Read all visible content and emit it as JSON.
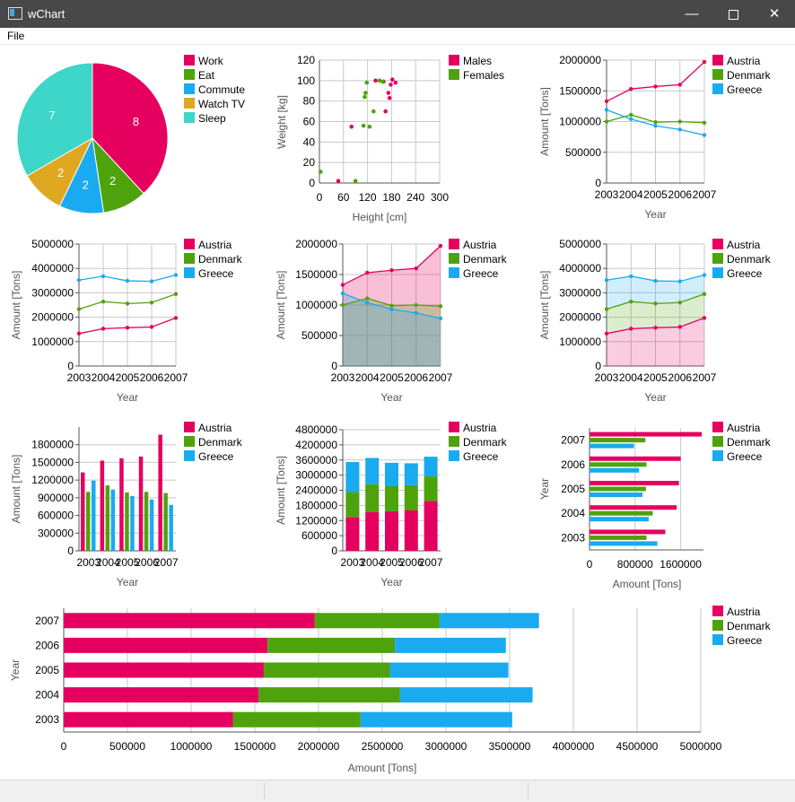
{
  "window": {
    "title": "wChart",
    "minimize_glyph": "—",
    "close_glyph": "✕"
  },
  "menu": {
    "file": "File"
  },
  "icons": [
    "app-icon",
    "minimize-icon",
    "maximize-icon",
    "close-icon"
  ],
  "colors": {
    "austria": "#e5005f",
    "denmark": "#4ea30c",
    "greece": "#1aaaf0",
    "work": "#e5005f",
    "eat": "#4ea30c",
    "commute": "#1aaaf0",
    "watch_tv": "#e0a820",
    "sleep": "#3dd6c8",
    "grid": "#c8c8c8",
    "axis": "#8a8a8a"
  },
  "chart_data": [
    {
      "type": "pie",
      "slices": [
        {
          "label": "Work",
          "value": 8
        },
        {
          "label": "Eat",
          "value": 2
        },
        {
          "label": "Commute",
          "value": 2
        },
        {
          "label": "Watch TV",
          "value": 2
        },
        {
          "label": "Sleep",
          "value": 7
        }
      ],
      "legend": "right"
    },
    {
      "type": "scatter",
      "xlabel": "Height [cm]",
      "ylabel": "Weight [kg]",
      "xlim": [
        0,
        300
      ],
      "ylim": [
        0,
        120
      ],
      "xticks": [
        "0",
        "60",
        "120",
        "180",
        "240",
        "300"
      ],
      "yticks": [
        "0",
        "20",
        "40",
        "60",
        "80",
        "100",
        "120"
      ],
      "series": [
        {
          "name": "Males",
          "points": [
            [
              47,
              2
            ],
            [
              80,
              55
            ],
            [
              140,
              100
            ],
            [
              160,
              99
            ],
            [
              165,
              70
            ],
            [
              172,
              88
            ],
            [
              175,
              83
            ],
            [
              178,
              96
            ],
            [
              182,
              101
            ],
            [
              190,
              98
            ]
          ]
        },
        {
          "name": "Females",
          "points": [
            [
              3,
              11
            ],
            [
              90,
              2
            ],
            [
              110,
              56
            ],
            [
              113,
              84
            ],
            [
              115,
              88
            ],
            [
              118,
              98
            ],
            [
              125,
              55
            ],
            [
              135,
              70
            ],
            [
              150,
              100
            ],
            [
              158,
              99
            ]
          ]
        }
      ],
      "grid": true,
      "legend": "right"
    },
    {
      "type": "line",
      "xlabel": "Year",
      "ylabel": "Amount [Tons]",
      "categories": [
        "2003",
        "2004",
        "2005",
        "2006",
        "2007"
      ],
      "ylim": [
        0,
        2000000
      ],
      "yticks": [
        "0",
        "500000",
        "1000000",
        "1500000",
        "2000000"
      ],
      "series": [
        {
          "name": "Austria",
          "values": [
            1330000,
            1530000,
            1570000,
            1600000,
            1970000
          ]
        },
        {
          "name": "Denmark",
          "values": [
            1000000,
            1110000,
            990000,
            1000000,
            980000
          ]
        },
        {
          "name": "Greece",
          "values": [
            1190000,
            1040000,
            930000,
            870000,
            780000
          ]
        }
      ],
      "grid": true,
      "legend": "right"
    },
    {
      "type": "line",
      "stacked": true,
      "xlabel": "Year",
      "ylabel": "Amount [Tons]",
      "categories": [
        "2003",
        "2004",
        "2005",
        "2006",
        "2007"
      ],
      "ylim": [
        0,
        5000000
      ],
      "yticks": [
        "0",
        "1000000",
        "2000000",
        "3000000",
        "4000000",
        "5000000"
      ],
      "series": [
        {
          "name": "Austria",
          "values": [
            1330000,
            1530000,
            1570000,
            1600000,
            1970000
          ]
        },
        {
          "name": "Denmark",
          "values": [
            1000000,
            1110000,
            990000,
            1000000,
            980000
          ]
        },
        {
          "name": "Greece",
          "values": [
            1190000,
            1040000,
            930000,
            870000,
            780000
          ]
        }
      ],
      "grid": true,
      "legend": "right"
    },
    {
      "type": "area",
      "xlabel": "Year",
      "ylabel": "Amount [Tons]",
      "categories": [
        "2003",
        "2004",
        "2005",
        "2006",
        "2007"
      ],
      "ylim": [
        0,
        2000000
      ],
      "yticks": [
        "0",
        "500000",
        "1000000",
        "1500000",
        "2000000"
      ],
      "series": [
        {
          "name": "Austria",
          "values": [
            1330000,
            1530000,
            1570000,
            1600000,
            1970000
          ]
        },
        {
          "name": "Denmark",
          "values": [
            1000000,
            1110000,
            990000,
            1000000,
            980000
          ]
        },
        {
          "name": "Greece",
          "values": [
            1190000,
            1040000,
            930000,
            870000,
            780000
          ]
        }
      ],
      "grid": true,
      "legend": "right"
    },
    {
      "type": "area",
      "stacked": true,
      "xlabel": "Year",
      "ylabel": "Amount [Tons]",
      "categories": [
        "2003",
        "2004",
        "2005",
        "2006",
        "2007"
      ],
      "ylim": [
        0,
        5000000
      ],
      "yticks": [
        "0",
        "1000000",
        "2000000",
        "3000000",
        "4000000",
        "5000000"
      ],
      "series": [
        {
          "name": "Austria",
          "values": [
            1330000,
            1530000,
            1570000,
            1600000,
            1970000
          ]
        },
        {
          "name": "Denmark",
          "values": [
            1000000,
            1110000,
            990000,
            1000000,
            980000
          ]
        },
        {
          "name": "Greece",
          "values": [
            1190000,
            1040000,
            930000,
            870000,
            780000
          ]
        }
      ],
      "grid": true,
      "legend": "right"
    },
    {
      "type": "bar",
      "xlabel": "Year",
      "ylabel": "Amount [Tons]",
      "categories": [
        "2003",
        "2004",
        "2005",
        "2006",
        "2007"
      ],
      "ylim": [
        0,
        2100000
      ],
      "yticks": [
        "0",
        "300000",
        "600000",
        "900000",
        "1200000",
        "1500000",
        "1800000"
      ],
      "series": [
        {
          "name": "Austria",
          "values": [
            1330000,
            1530000,
            1570000,
            1600000,
            1970000
          ]
        },
        {
          "name": "Denmark",
          "values": [
            1000000,
            1110000,
            990000,
            1000000,
            980000
          ]
        },
        {
          "name": "Greece",
          "values": [
            1190000,
            1040000,
            930000,
            870000,
            780000
          ]
        }
      ],
      "grid": true,
      "legend": "right"
    },
    {
      "type": "bar",
      "stacked": true,
      "xlabel": "Year",
      "ylabel": "Amount [Tons]",
      "categories": [
        "2003",
        "2004",
        "2005",
        "2006",
        "2007"
      ],
      "ylim": [
        0,
        4800000
      ],
      "yticks": [
        "0",
        "600000",
        "1200000",
        "1800000",
        "2400000",
        "3000000",
        "3600000",
        "4200000",
        "4800000"
      ],
      "series": [
        {
          "name": "Austria",
          "values": [
            1330000,
            1530000,
            1570000,
            1600000,
            1970000
          ]
        },
        {
          "name": "Denmark",
          "values": [
            1000000,
            1110000,
            990000,
            1000000,
            980000
          ]
        },
        {
          "name": "Greece",
          "values": [
            1190000,
            1040000,
            930000,
            870000,
            780000
          ]
        }
      ],
      "grid": true,
      "legend": "right"
    },
    {
      "type": "bar",
      "orientation": "horizontal",
      "xlabel": "Amount [Tons]",
      "ylabel": "Year",
      "categories": [
        "2003",
        "2004",
        "2005",
        "2006",
        "2007"
      ],
      "xlim": [
        0,
        2000000
      ],
      "xticks": [
        "0",
        "800000",
        "1600000"
      ],
      "series": [
        {
          "name": "Austria",
          "values": [
            1330000,
            1530000,
            1570000,
            1600000,
            1970000
          ]
        },
        {
          "name": "Denmark",
          "values": [
            1000000,
            1110000,
            990000,
            1000000,
            980000
          ]
        },
        {
          "name": "Greece",
          "values": [
            1190000,
            1040000,
            930000,
            870000,
            780000
          ]
        }
      ],
      "grid": true,
      "legend": "right"
    },
    {
      "type": "bar",
      "orientation": "horizontal",
      "stacked": true,
      "xlabel": "Amount [Tons]",
      "ylabel": "Year",
      "categories": [
        "2003",
        "2004",
        "2005",
        "2006",
        "2007"
      ],
      "xlim": [
        0,
        5000000
      ],
      "xticks": [
        "0",
        "500000",
        "1000000",
        "1500000",
        "2000000",
        "2500000",
        "3000000",
        "3500000",
        "4000000",
        "4500000",
        "5000000"
      ],
      "series": [
        {
          "name": "Austria",
          "values": [
            1330000,
            1530000,
            1570000,
            1600000,
            1970000
          ]
        },
        {
          "name": "Denmark",
          "values": [
            1000000,
            1110000,
            990000,
            1000000,
            980000
          ]
        },
        {
          "name": "Greece",
          "values": [
            1190000,
            1040000,
            930000,
            870000,
            780000
          ]
        }
      ],
      "grid": true,
      "legend": "right"
    }
  ]
}
